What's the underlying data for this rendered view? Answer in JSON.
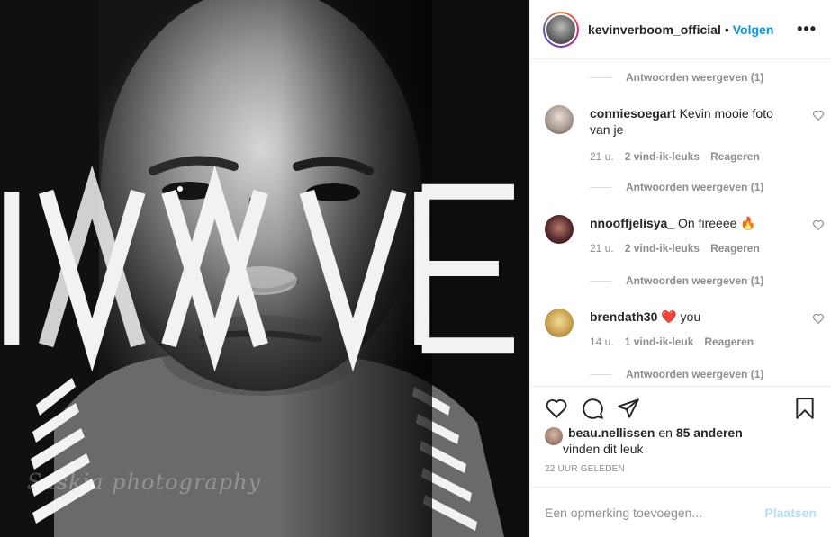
{
  "header": {
    "username": "kevinverboom_official",
    "separator": "•",
    "follow_label": "Volgen",
    "more_label": "•••"
  },
  "photo": {
    "watermark_logo_text": "IAM ME",
    "watermark_signature": "Saskia photography"
  },
  "comments": {
    "replies_label": "Antwoorden weergeven (1)",
    "items": [
      {
        "username": "conniesoegart",
        "text": "Kevin mooie foto van je",
        "time": "21 u.",
        "likes": "",
        "reply_label": "Reageren"
      },
      {
        "username": "nnooffjelisya_",
        "text": "On fireeee 🔥",
        "time": "21 u.",
        "likes": "2 vind-ik-leuks",
        "reply_label": "Reageren"
      },
      {
        "username": "brendath30",
        "text": "❤️ you",
        "time": "14 u.",
        "likes": "1 vind-ik-leuk",
        "reply_label": "Reageren"
      }
    ],
    "first_likes": "2 vind-ik-leuks"
  },
  "likes": {
    "liker": "beau.nellissen",
    "conj": "en",
    "others": "85 anderen",
    "suffix": "vinden dit leuk"
  },
  "time_ago": "22 UUR GELEDEN",
  "add_comment": {
    "placeholder": "Een opmerking toevoegen...",
    "post_label": "Plaatsen"
  },
  "colors": {
    "accent": "#0095f6",
    "post_disabled": "#b2dffc",
    "secondary_text": "#8e8e8e"
  }
}
